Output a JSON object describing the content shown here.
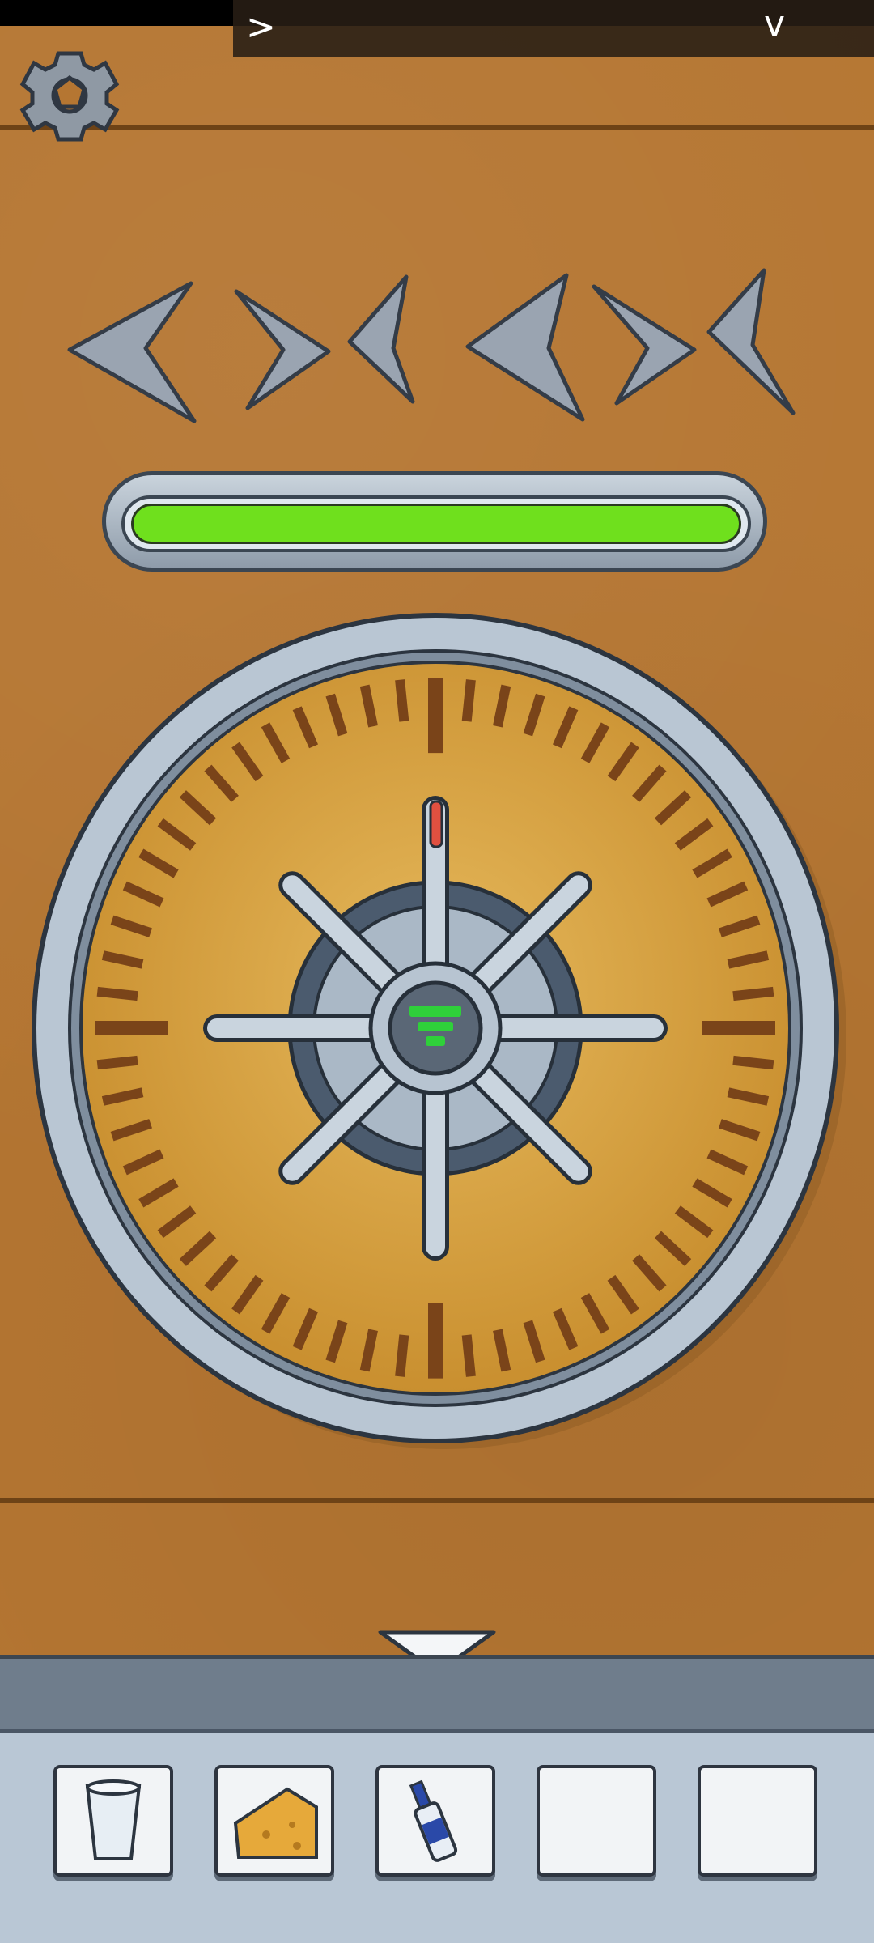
{
  "overlay": {
    "left_symbol": ">",
    "right_symbol": "v"
  },
  "settings": {
    "icon": "gear-icon"
  },
  "symbol_sequence": [
    "left-arrow",
    "right-arrow",
    "left-fin",
    "left-fin",
    "right-hook",
    "left-fin"
  ],
  "progress": {
    "fraction": 1.0,
    "color": "#6fe01d"
  },
  "safe_dial": {
    "tick_count": 60,
    "handle_spokes": 8,
    "center_indicator": "green-signal-icon"
  },
  "navigation": {
    "down_arrow_icon": "chevron-down-icon"
  },
  "inventory": {
    "slots": [
      {
        "item": "cup-icon"
      },
      {
        "item": "cheese-icon"
      },
      {
        "item": "glue-bottle-icon"
      },
      {
        "item": ""
      },
      {
        "item": ""
      }
    ]
  },
  "colors": {
    "wood": "#b57632",
    "dial_face": "#d8a447",
    "tick": "#7a4419",
    "metal": "#b9c6d3",
    "progress_green": "#6fe01d",
    "indicator_green": "#2fd03a"
  }
}
